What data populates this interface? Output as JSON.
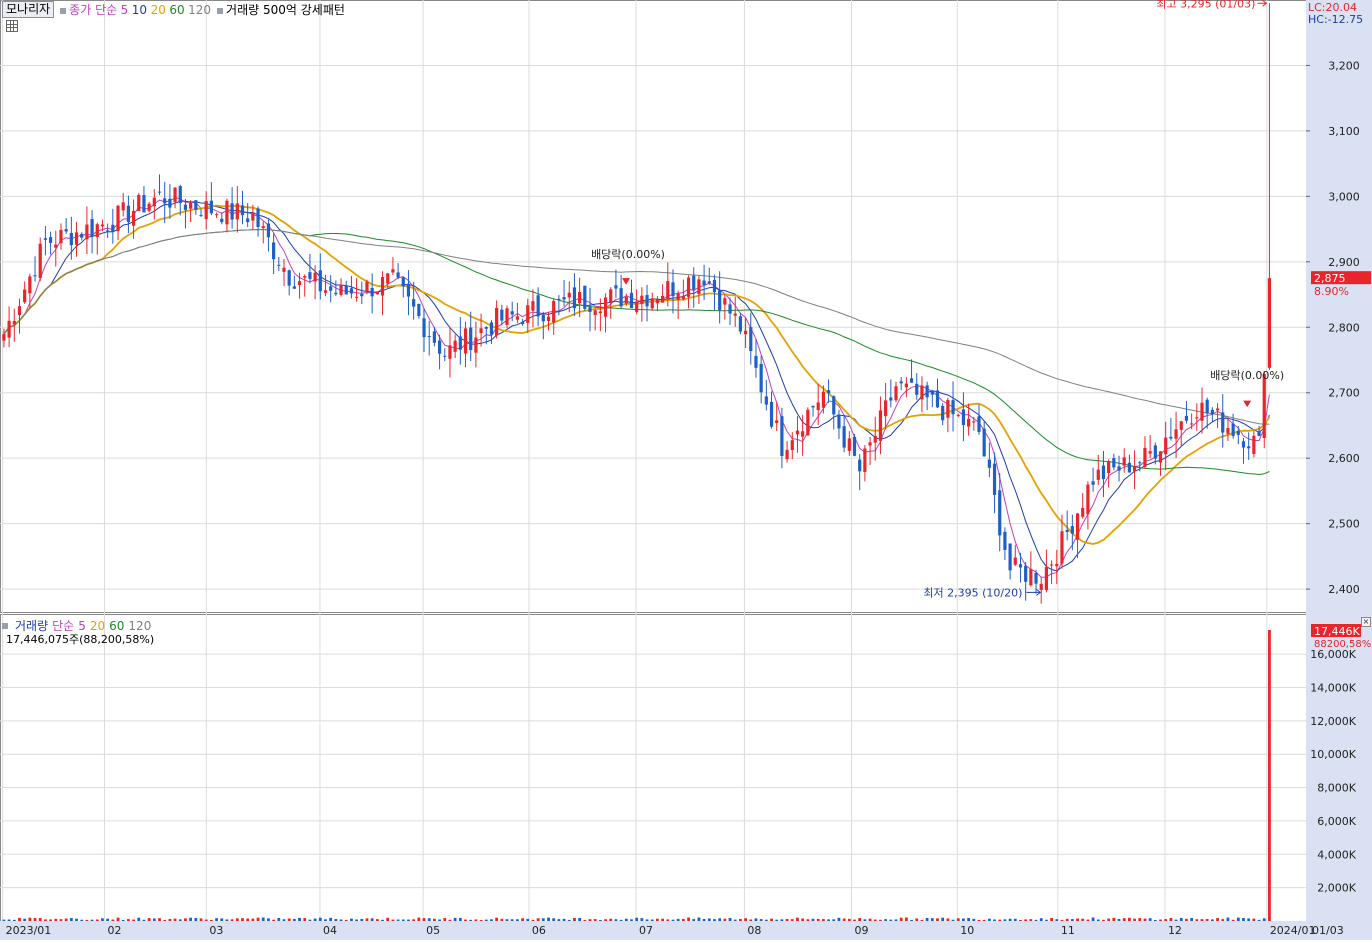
{
  "header": {
    "stock_name": "모나리자",
    "ma_prefix": "종가 단순",
    "ma_periods": [
      "5",
      "10",
      "20",
      "60",
      "120"
    ],
    "volume_pattern": "거래량 500억 강세패턴",
    "lc": "LC:20.04",
    "hc": "HC:-12.75"
  },
  "colors": {
    "up": "#e8252a",
    "down": "#1f5fc8",
    "ma5": "#c040c0",
    "ma10": "#1e3ea8",
    "ma20": "#e6a100",
    "ma60": "#1a8a2a",
    "ma120": "#808080",
    "axis_bg": "#d9e1f2",
    "grid": "#dcdcdc"
  },
  "annotations": {
    "high_label": "최고 3,295 (01/03)",
    "low_label": "최저 2,395 (10/20)",
    "dividend_1": "배당락(0.00%)",
    "dividend_2": "배당락(0.00%)",
    "current_price": "2,875",
    "current_change": "8.90%"
  },
  "volume_panel": {
    "legend_title": "거래량",
    "legend_ma": "단순",
    "legend_periods": [
      "5",
      "20",
      "60",
      "120"
    ],
    "info": "17,446,075주(88,200,58%)",
    "current_label": "17,446K",
    "current_sub": "88200,58%"
  },
  "chart_data": [
    {
      "type": "candlestick",
      "title": "",
      "x_ticks": [
        "2023/01",
        "02",
        "03",
        "04",
        "05",
        "06",
        "07",
        "08",
        "09",
        "10",
        "11",
        "12",
        "2024/01",
        "01/03"
      ],
      "y_ticks": [
        "2,400",
        "2,500",
        "2,600",
        "2,700",
        "2,800",
        "2,900",
        "3,000",
        "3,100",
        "3,200"
      ],
      "ylim": [
        2365,
        3300
      ],
      "grid": true,
      "key_points": [
        {
          "month": "2023/01",
          "price": 2780
        },
        {
          "month": "02",
          "price": 2990
        },
        {
          "month": "03",
          "price": 2970
        },
        {
          "month": "04",
          "price": 2870
        },
        {
          "month": "05",
          "price": 2800
        },
        {
          "month": "06",
          "price": 2830
        },
        {
          "month": "07",
          "price": 2850
        },
        {
          "month": "08",
          "price": 2700
        },
        {
          "month": "09",
          "price": 2690
        },
        {
          "month": "10",
          "price": 2430
        },
        {
          "month": "11",
          "price": 2620
        },
        {
          "month": "12",
          "price": 2660
        },
        {
          "month": "2024/01",
          "price": 2875
        }
      ],
      "high": 3295,
      "low": 2395,
      "last_close": 2875
    },
    {
      "type": "bar",
      "title": "",
      "y_ticks": [
        "2,000K",
        "4,000K",
        "6,000K",
        "8,000K",
        "10,000K",
        "12,000K",
        "14,000K",
        "16,000K"
      ],
      "ylim": [
        0,
        17446
      ],
      "last_volume_k": 17446,
      "typical_volume_k": 150
    }
  ]
}
